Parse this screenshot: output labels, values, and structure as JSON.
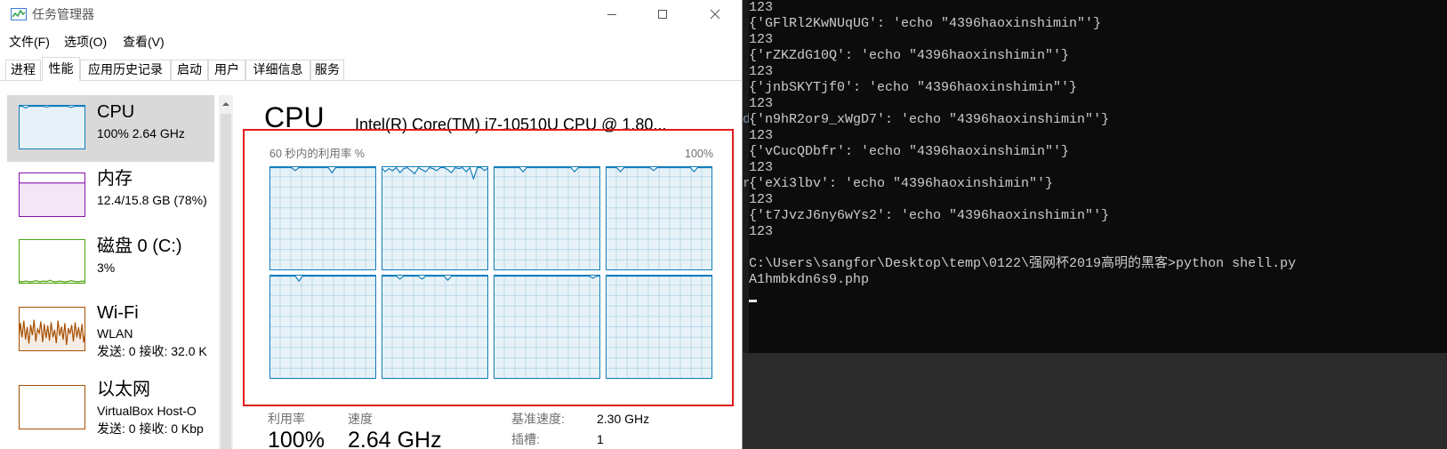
{
  "window": {
    "title": "任务管理器"
  },
  "menu": {
    "file": "文件(F)",
    "options": "选项(O)",
    "view": "查看(V)"
  },
  "tabs": [
    {
      "label": "进程"
    },
    {
      "label": "性能",
      "active": true
    },
    {
      "label": "应用历史记录"
    },
    {
      "label": "启动"
    },
    {
      "label": "用户"
    },
    {
      "label": "详细信息"
    },
    {
      "label": "服务"
    }
  ],
  "sidebar": {
    "selected": "CPU",
    "items": [
      {
        "title": "CPU",
        "lines": [
          "100% 2.64 GHz"
        ],
        "color": "#117dbb",
        "samples": [
          100,
          100,
          96,
          100,
          100,
          100,
          100,
          100,
          98,
          100,
          100,
          100,
          100,
          100,
          100,
          97,
          100,
          100,
          100,
          100
        ]
      },
      {
        "title": "内存",
        "lines": [
          "12.4/15.8 GB (78%)"
        ],
        "color": "#8b12ae",
        "samples": [
          78,
          78,
          78,
          78,
          78,
          78,
          78,
          78,
          78,
          78
        ]
      },
      {
        "title": "磁盘 0 (C:)",
        "lines": [
          "3%"
        ],
        "color": "#4da60c",
        "samples": [
          2,
          1,
          3,
          1,
          2,
          4,
          1,
          3,
          2,
          5,
          1,
          2,
          3,
          1,
          2,
          4,
          2,
          1,
          3,
          2
        ]
      },
      {
        "title": "Wi-Fi",
        "lines": [
          "WLAN",
          "发送: 0 接收: 32.0 K"
        ],
        "color": "#a74f01",
        "samples": [
          20,
          65,
          30,
          70,
          25,
          55,
          15,
          60,
          35,
          72,
          20,
          50,
          40,
          68,
          18,
          62,
          28,
          58,
          22,
          66,
          30,
          48,
          16,
          70,
          34,
          56,
          24,
          64,
          12,
          52,
          38,
          60,
          20,
          66,
          30,
          54,
          26,
          62,
          18,
          44
        ]
      },
      {
        "title": "以太网",
        "lines": [
          "VirtualBox Host-O",
          "发送: 0 接收: 0 Kbp"
        ],
        "color": "#a74f01",
        "samples": []
      }
    ]
  },
  "main": {
    "title": "CPU",
    "processor": "Intel(R) Core(TM) i7-10510U CPU @ 1.80...",
    "graph_caption": "60 秒内的利用率 %",
    "graph_max_label": "100%",
    "graph_color": "#117dbb",
    "cores": [
      {
        "utilization_samples": [
          100,
          100,
          100,
          100,
          100,
          100,
          100,
          97,
          100,
          100,
          100,
          100,
          100,
          100,
          100,
          100,
          100,
          95,
          100,
          100,
          100,
          100,
          100,
          100,
          100,
          100,
          100,
          100,
          100,
          100
        ]
      },
      {
        "utilization_samples": [
          100,
          96,
          99,
          97,
          100,
          95,
          99,
          100,
          97,
          94,
          100,
          98,
          96,
          100,
          99,
          97,
          100,
          100,
          98,
          95,
          100,
          99,
          100,
          96,
          100,
          89,
          100,
          100,
          97,
          100
        ]
      },
      {
        "utilization_samples": [
          100,
          100,
          100,
          100,
          100,
          100,
          100,
          100,
          96,
          100,
          100,
          100,
          100,
          100,
          100,
          100,
          100,
          100,
          100,
          100,
          100,
          100,
          96,
          100,
          100,
          100,
          100,
          100,
          100,
          100
        ]
      },
      {
        "utilization_samples": [
          100,
          100,
          100,
          100,
          96,
          100,
          100,
          100,
          100,
          100,
          100,
          100,
          100,
          97,
          100,
          100,
          100,
          100,
          100,
          100,
          100,
          100,
          100,
          100,
          96,
          100,
          100,
          100,
          100,
          100
        ]
      },
      {
        "utilization_samples": [
          100,
          100,
          100,
          100,
          100,
          100,
          100,
          100,
          95,
          100,
          100,
          100,
          100,
          100,
          100,
          100,
          100,
          100,
          100,
          100,
          100,
          100,
          100,
          100,
          100,
          100,
          100,
          100,
          100,
          100
        ]
      },
      {
        "utilization_samples": [
          100,
          100,
          100,
          100,
          100,
          97,
          100,
          100,
          100,
          100,
          100,
          97,
          100,
          100,
          100,
          100,
          100,
          100,
          96,
          100,
          100,
          100,
          100,
          100,
          100,
          100,
          100,
          100,
          100,
          100
        ]
      },
      {
        "utilization_samples": [
          100,
          100,
          100,
          100,
          100,
          100,
          100,
          100,
          100,
          100,
          100,
          100,
          100,
          100,
          100,
          100,
          100,
          100,
          100,
          100,
          100,
          100,
          100,
          100,
          100,
          100,
          100,
          98,
          100,
          100
        ]
      },
      {
        "utilization_samples": [
          100,
          100,
          100,
          100,
          100,
          100,
          100,
          100,
          100,
          100,
          100,
          100,
          100,
          100,
          100,
          100,
          100,
          100,
          100,
          100,
          100,
          100,
          100,
          100,
          100,
          100,
          100,
          100,
          100,
          100
        ]
      }
    ],
    "stats": {
      "utilization_label": "利用率",
      "utilization": "100%",
      "speed_label": "速度",
      "speed": "2.64 GHz",
      "base_speed_label": "基准速度:",
      "base_speed": "2.30 GHz",
      "sockets_label": "插槽:",
      "sockets": "1"
    }
  },
  "annotation": {
    "highlight_color": "#e31b1b"
  },
  "console": {
    "backdrop_fragments": [
      "d",
      "r"
    ],
    "lines": [
      "123",
      "{'GFlRl2KwNUqUG': 'echo \"4396haoxinshimin\"'}",
      "123",
      "{'rZKZdG10Q': 'echo \"4396haoxinshimin\"'}",
      "123",
      "{'jnbSKYTjf0': 'echo \"4396haoxinshimin\"'}",
      "123",
      "{'n9hR2or9_xWgD7': 'echo \"4396haoxinshimin\"'}",
      "123",
      "{'vCucQDbfr': 'echo \"4396haoxinshimin\"'}",
      "123",
      "{'eXi3lbv': 'echo \"4396haoxinshimin\"'}",
      "123",
      "{'t7JvzJ6ny6wYs2': 'echo \"4396haoxinshimin\"'}",
      "123",
      "",
      "C:\\Users\\sangfor\\Desktop\\temp\\0122\\强网杯2019高明的黑客>python shell.py",
      "A1hmbkdn6s9.php"
    ]
  }
}
